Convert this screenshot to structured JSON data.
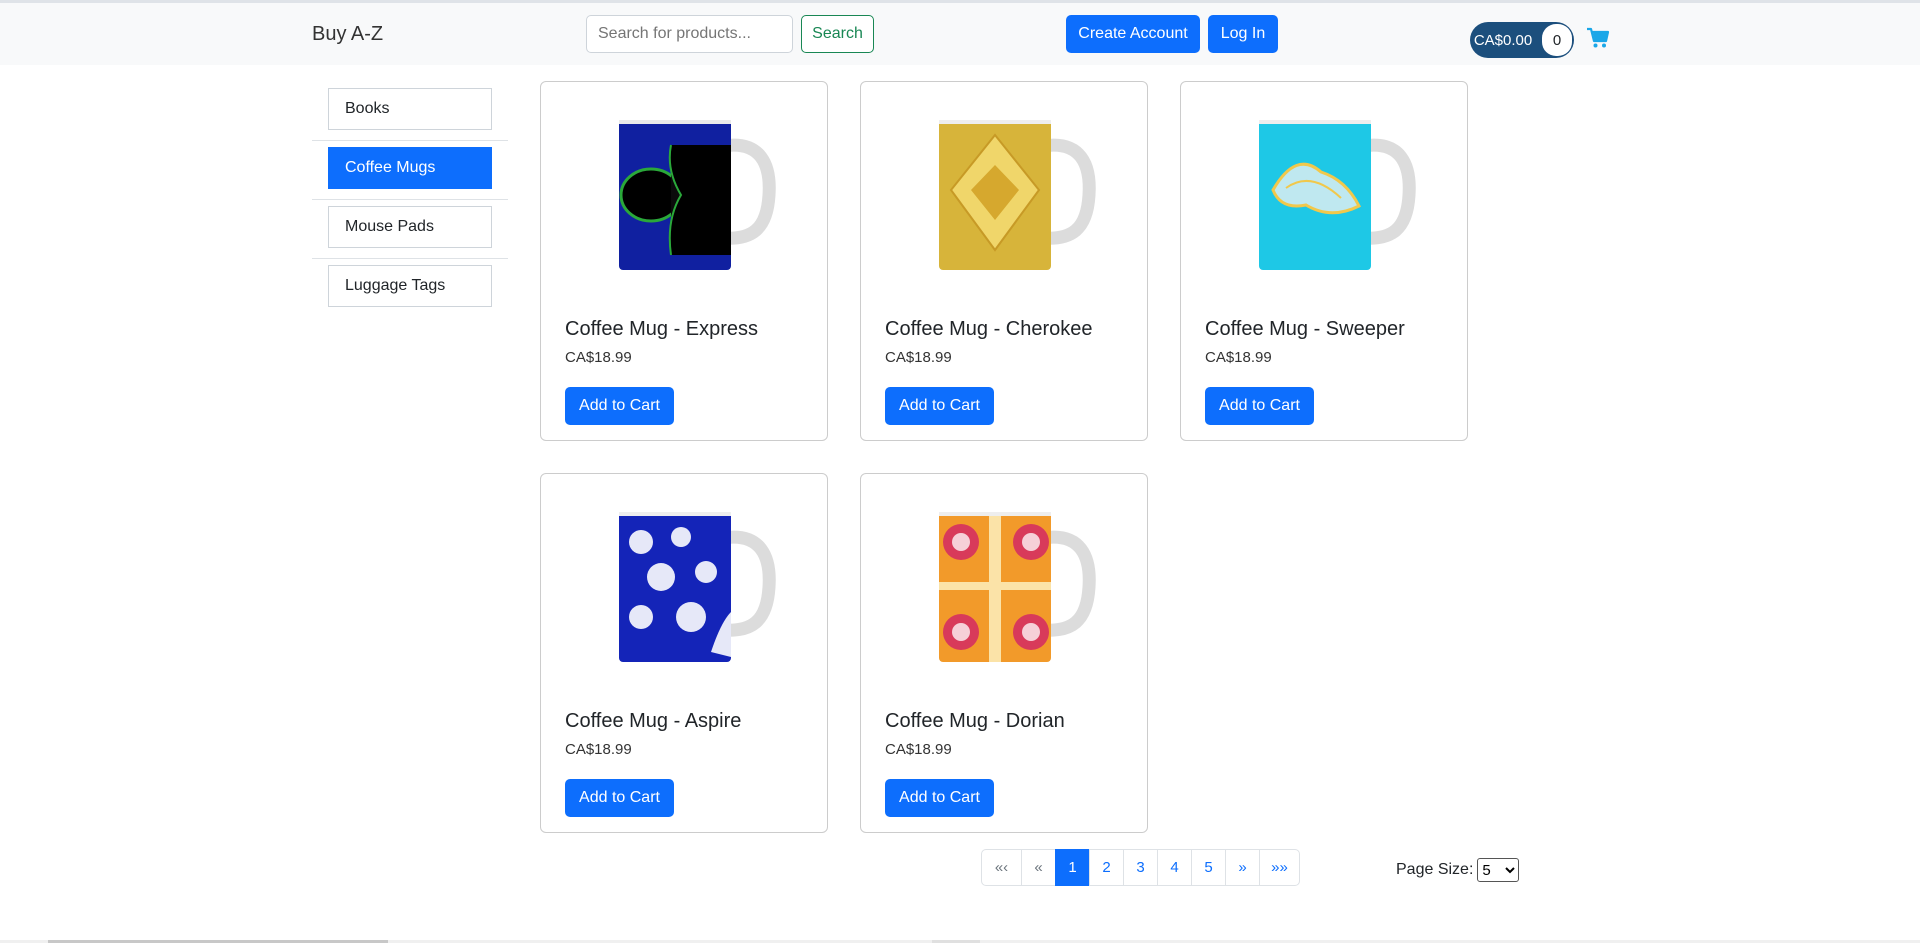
{
  "header": {
    "brand": "Buy A-Z",
    "search_placeholder": "Search for products...",
    "search_label": "Search",
    "create_account_label": "Create Account",
    "login_label": "Log In",
    "cart_total": "CA$0.00",
    "cart_count": "0",
    "cart_icon": "shopping-cart-icon"
  },
  "sidebar": {
    "items": [
      {
        "label": "Books",
        "active": false
      },
      {
        "label": "Coffee Mugs",
        "active": true
      },
      {
        "label": "Mouse Pads",
        "active": false
      },
      {
        "label": "Luggage Tags",
        "active": false
      }
    ]
  },
  "products": [
    {
      "title": "Coffee Mug - Express",
      "price": "CA$18.99",
      "button": "Add to Cart"
    },
    {
      "title": "Coffee Mug - Cherokee",
      "price": "CA$18.99",
      "button": "Add to Cart"
    },
    {
      "title": "Coffee Mug - Sweeper",
      "price": "CA$18.99",
      "button": "Add to Cart"
    },
    {
      "title": "Coffee Mug - Aspire",
      "price": "CA$18.99",
      "button": "Add to Cart"
    },
    {
      "title": "Coffee Mug - Dorian",
      "price": "CA$18.99",
      "button": "Add to Cart"
    }
  ],
  "pagination": {
    "first": "«‹",
    "prev": "«",
    "pages": [
      "1",
      "2",
      "3",
      "4",
      "5"
    ],
    "current": "1",
    "next": "»",
    "last": "»»"
  },
  "page_size": {
    "label": "Page Size:",
    "selected": "5"
  },
  "colors": {
    "primary": "#0d6efd",
    "success": "#198754",
    "cart_pill": "#1c4f7d",
    "cart_icon": "#1aa7e8"
  }
}
